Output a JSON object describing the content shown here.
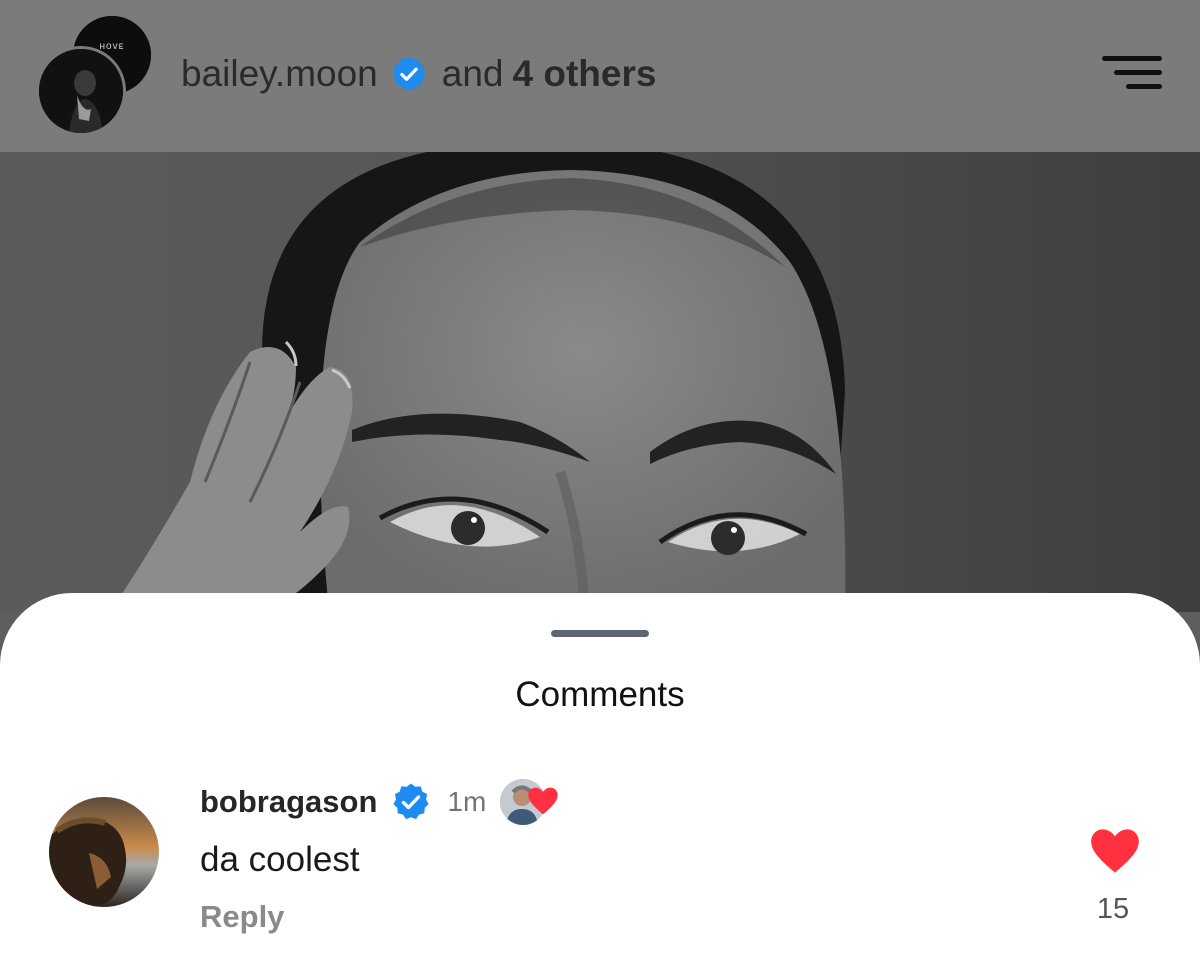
{
  "header": {
    "username": "bailey.moon",
    "verified": true,
    "and_text": "and",
    "others_text": "4 others",
    "avatar_back_text": "ʜᴏᴠᴇ",
    "menu_icon": "hamburger-menu-icon"
  },
  "post": {
    "image": "black-and-white portrait"
  },
  "comments_sheet": {
    "title": "Comments",
    "comments": [
      {
        "username": "bobragason",
        "verified": true,
        "time": "1m",
        "creator_liked": true,
        "text": "da coolest",
        "reply_label": "Reply",
        "like_count": "15",
        "liked": true
      }
    ]
  },
  "colors": {
    "verified_badge": "#1D8BF0",
    "heart": "#FF3040",
    "header_bg": "#7B7B7B",
    "sheet_bg": "#FFFFFF"
  }
}
